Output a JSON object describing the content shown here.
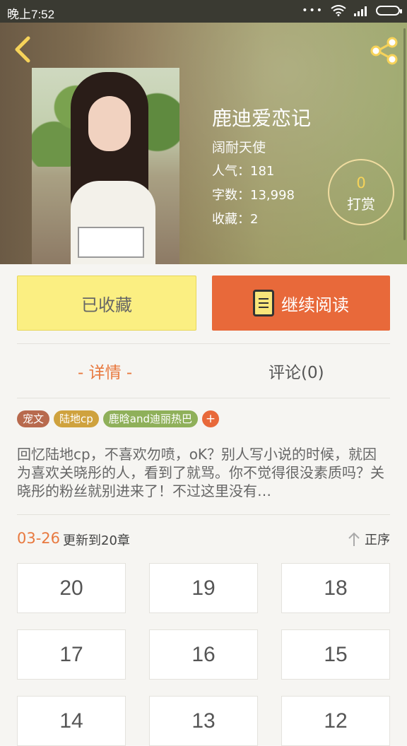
{
  "status_bar": {
    "time": "晚上7:52",
    "dots": "•••"
  },
  "header": {
    "title": "鹿迪爱恋记",
    "author": "阔耐天使",
    "popularity": "人气：181",
    "word_count": "字数：13,998",
    "favorites": "收藏：2",
    "tip_count": "0",
    "tip_label": "打赏"
  },
  "actions": {
    "favorite_label": "已收藏",
    "read_label": "继续阅读"
  },
  "tabs": {
    "details": "- 详情 -",
    "comments": "评论(0)"
  },
  "tags": [
    {
      "label": "宠文",
      "color": "#b86a4e"
    },
    {
      "label": "陆地cp",
      "color": "#cfa23e"
    },
    {
      "label": "鹿晗and迪丽热巴",
      "color": "#8fb05a"
    }
  ],
  "tag_add": "+",
  "description": "回忆陆地cp，不喜欢勿喷，oK？别人写小说的时候，就因为喜欢关晓彤的人，看到了就骂。你不觉得很没素质吗？关晓彤的粉丝就别进来了！不过这里没有…",
  "update": {
    "date": "03-26",
    "text": "更新到20章",
    "order_label": "正序"
  },
  "chapters": [
    "20",
    "19",
    "18",
    "17",
    "16",
    "15",
    "14",
    "13",
    "12"
  ]
}
